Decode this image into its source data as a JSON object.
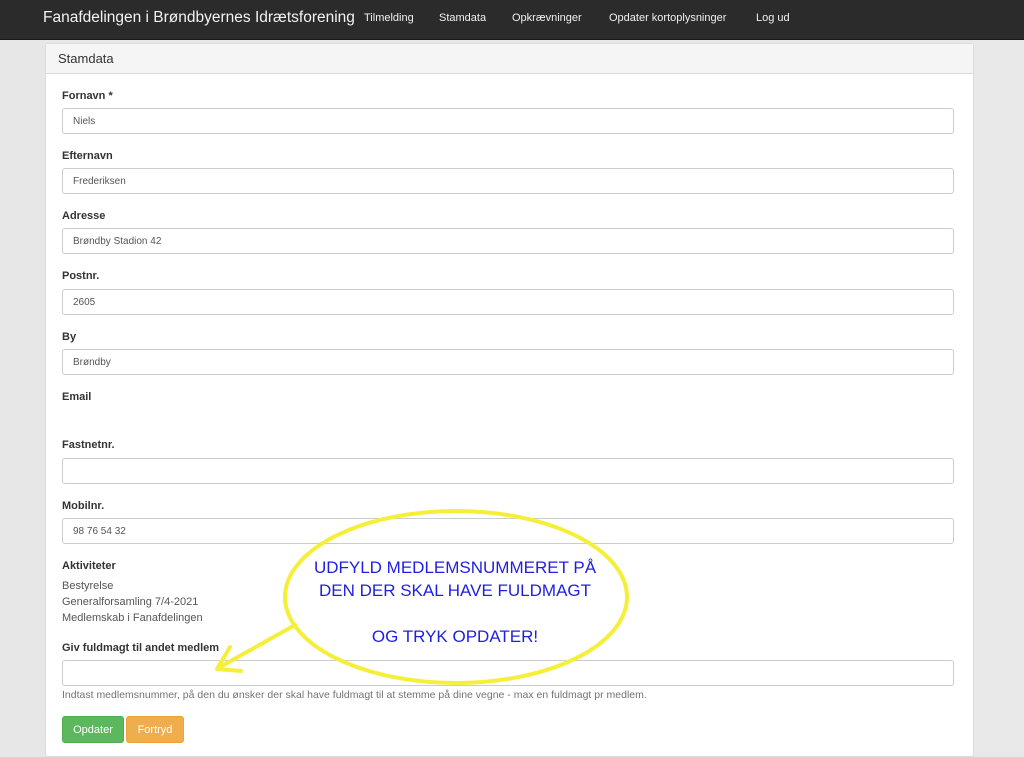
{
  "navbar": {
    "brand": "Fanafdelingen i Brøndbyernes Idrætsforening",
    "links": [
      "Tilmelding",
      "Stamdata",
      "Opkrævninger",
      "Opdater kortoplysninger",
      "Log ud"
    ]
  },
  "panel": {
    "title": "Stamdata"
  },
  "form": {
    "fornavn": {
      "label": "Fornavn *",
      "value": "Niels"
    },
    "efternavn": {
      "label": "Efternavn",
      "value": "Frederiksen"
    },
    "adresse": {
      "label": "Adresse",
      "value": "Brøndby Stadion 42"
    },
    "postnr": {
      "label": "Postnr.",
      "value": "2605"
    },
    "by": {
      "label": "By",
      "value": "Brøndby"
    },
    "email": {
      "label": "Email"
    },
    "fastnet": {
      "label": "Fastnetnr.",
      "value": ""
    },
    "mobil": {
      "label": "Mobilnr.",
      "value": "98 76 54 32"
    },
    "aktiviteter": {
      "label": "Aktiviteter",
      "items": [
        "Bestyrelse",
        "Generalforsamling 7/4-2021",
        "Medlemskab i Fanafdelingen"
      ]
    },
    "fuldmagt": {
      "label": "Giv fuldmagt til andet medlem",
      "value": "",
      "help": "Indtast medlemsnummer, på den du ønsker der skal have fuldmagt til at stemme på dine vegne - max en fuldmagt pr medlem."
    }
  },
  "buttons": {
    "update": "Opdater",
    "cancel": "Fortryd"
  },
  "annotation": {
    "line1": "UDFYLD MEDLEMSNUMMERET PÅ",
    "line2": "DEN DER SKAL HAVE FULDMAGT",
    "line3": "OG TRYK OPDATER!",
    "bubble_color": "#f5ef3a",
    "text_color": "#1f1fe0"
  },
  "colors": {
    "navbar": "#2b2b2b",
    "update_button": "#5cb85c",
    "cancel_button": "#f0ad4e"
  }
}
